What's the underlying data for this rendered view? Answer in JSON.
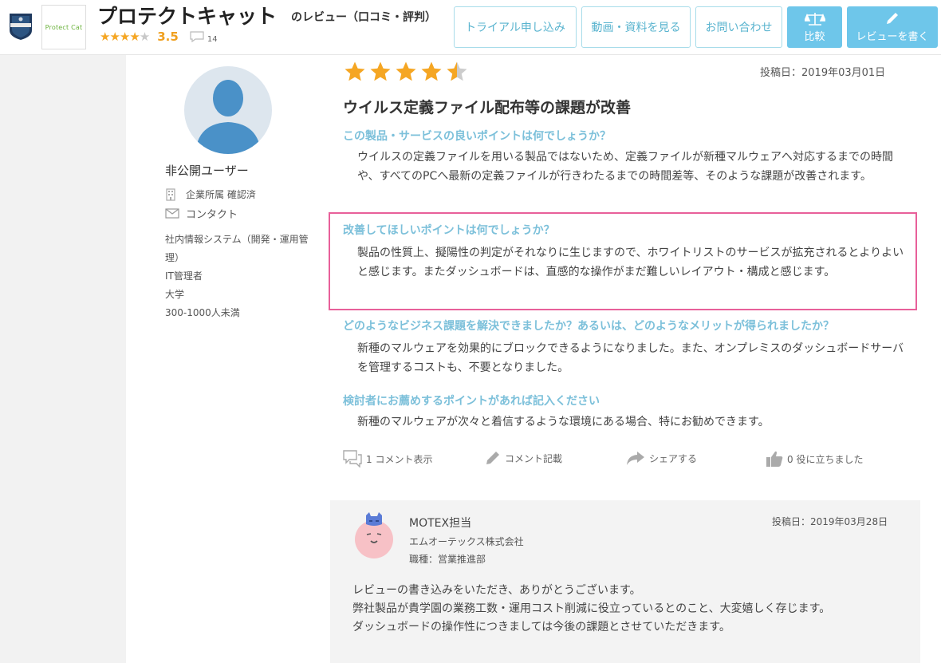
{
  "header": {
    "product_name": "プロテクトキャット",
    "review_suffix": "のレビュー（口コミ・評判）",
    "rating": "3.5",
    "comment_count": "14",
    "logo_text": "Protect Cat",
    "buttons": {
      "trial": "トライアル申し込み",
      "materials": "動画・資料を見る",
      "contact": "お問い合わせ",
      "compare": "比較",
      "write_review": "レビューを書く"
    }
  },
  "profile": {
    "name": "非公開ユーザー",
    "affiliation": "企業所属 確認済",
    "contact": "コンタクト",
    "lines": [
      "社内情報システム（開発・運用管理）",
      "IT管理者",
      "大学",
      "300-1000人未満"
    ]
  },
  "review": {
    "rating": 4.5,
    "post_date": "投稿日：2019年03月01日",
    "title": "ウイルス定義ファイル配布等の課題が改善",
    "qa": [
      {
        "q": "この製品・サービスの良いポイントは何でしょうか？",
        "a": "ウイルスの定義ファイルを用いる製品ではないため、定義ファイルが新種マルウェアへ対応するまでの時間や、すべてのPCへ最新の定義ファイルが行きわたるまでの時間差等、そのような課題が改善されます。"
      },
      {
        "q": "改善してほしいポイントは何でしょうか？",
        "a": "製品の性質上、擬陽性の判定がそれなりに生じますので、ホワイトリストのサービスが拡充されるとよりよいと感じます。またダッシュボードは、直感的な操作がまだ難しいレイアウト・構成と感じます。"
      },
      {
        "q": "どのようなビジネス課題を解決できましたか？あるいは、どのようなメリットが得られましたか？",
        "a": "新種のマルウェアを効果的にブロックできるようになりました。また、オンプレミスのダッシュボードサーバを管理するコストも、不要となりました。"
      },
      {
        "q": "検討者にお薦めするポイントがあれば記入ください",
        "a": "新種のマルウェアが次々と着信するような環境にある場合、特にお勧めできます。"
      }
    ],
    "actions": {
      "comments": "1 コメント表示",
      "write_comment": "コメント記載",
      "share": "シェアする",
      "helpful": "0 役に立ちました"
    }
  },
  "reply": {
    "name": "MOTEX担当",
    "company": "エムオーテックス株式会社",
    "role": "職種：営業推進部",
    "post_date": "投稿日：2019年03月28日",
    "lines": [
      "レビューの書き込みをいただき、ありがとうございます。",
      "弊社製品が貴学園の業務工数・運用コスト削減に役立っているとのこと、大変嬉しく存じます。",
      "ダッシュボードの操作性につきましては今後の課題とさせていただきます。"
    ]
  },
  "colors": {
    "accent": "#6ec6ea",
    "star": "#f5a623",
    "question": "#7cc0da",
    "highlight": "#e8609a"
  }
}
